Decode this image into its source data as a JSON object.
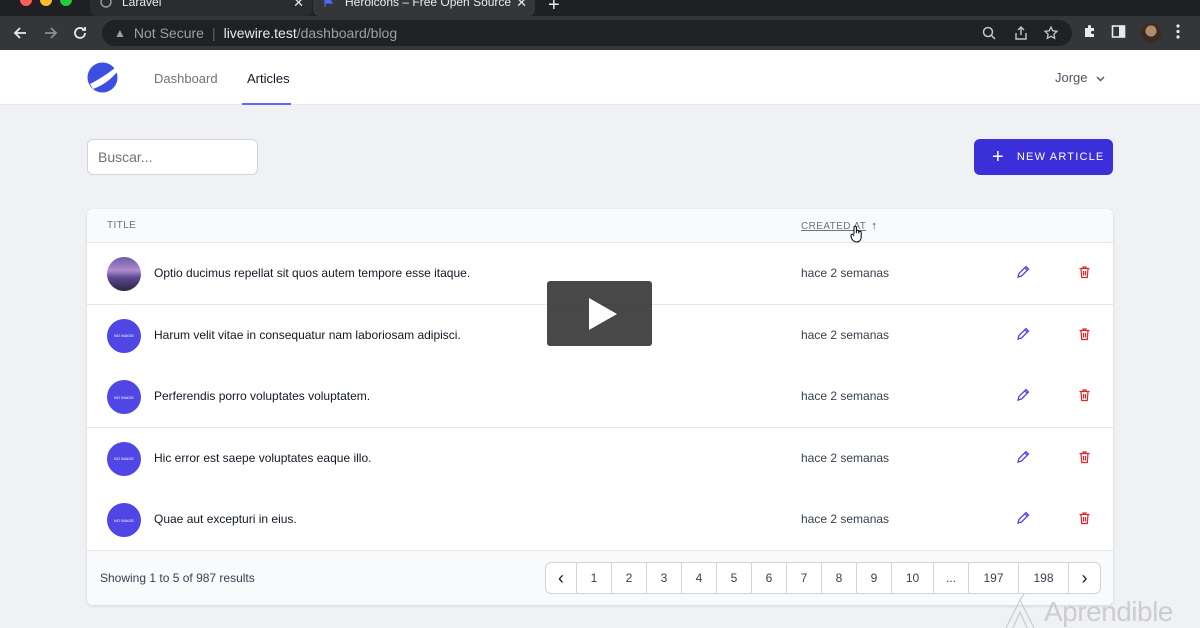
{
  "browser": {
    "tabs": [
      {
        "title": "Laravel",
        "close": "✕"
      },
      {
        "title": "Heroicons – Free Open Source",
        "close": "✕"
      }
    ],
    "new_tab": "+",
    "security_label": "Not Secure",
    "url_host": "livewire.test",
    "url_path": "/dashboard/blog"
  },
  "header": {
    "nav": [
      "Dashboard",
      "Articles"
    ],
    "active_nav": "Articles",
    "user": "Jorge"
  },
  "toolbar": {
    "search_placeholder": "Buscar...",
    "new_article_label": "NEW ARTICLE"
  },
  "table": {
    "columns": {
      "title": "TITLE",
      "created": "CREATED AT"
    },
    "sort_indicator": "↑",
    "rows": [
      {
        "title": "Optio ducimus repellat sit quos autem tempore esse itaque.",
        "created": "hace 2 semanas",
        "thumb": "photo"
      },
      {
        "title": "Harum velit vitae in consequatur nam laboriosam adipisci.",
        "created": "hace 2 semanas",
        "thumb": "NO IMAGE"
      },
      {
        "title": "Perferendis porro voluptates voluptatem.",
        "created": "hace 2 semanas",
        "thumb": "NO IMAGE"
      },
      {
        "title": "Hic error est saepe voluptates eaque illo.",
        "created": "hace 2 semanas",
        "thumb": "NO IMAGE"
      },
      {
        "title": "Quae aut excepturi in eius.",
        "created": "hace 2 semanas",
        "thumb": "NO IMAGE"
      }
    ]
  },
  "pagination": {
    "summary": "Showing 1 to 5 of 987 results",
    "prev": "‹",
    "next": "›",
    "pages": [
      "1",
      "2",
      "3",
      "4",
      "5",
      "6",
      "7",
      "8",
      "9",
      "10",
      "...",
      "197",
      "198"
    ]
  },
  "watermark": "Aprendible",
  "colors": {
    "primary": "#3b2fd9",
    "accent_underline": "#6366f1",
    "thumb": "#4f46e5",
    "edit_icon": "#4f46e5",
    "delete_icon": "#dc2626"
  }
}
